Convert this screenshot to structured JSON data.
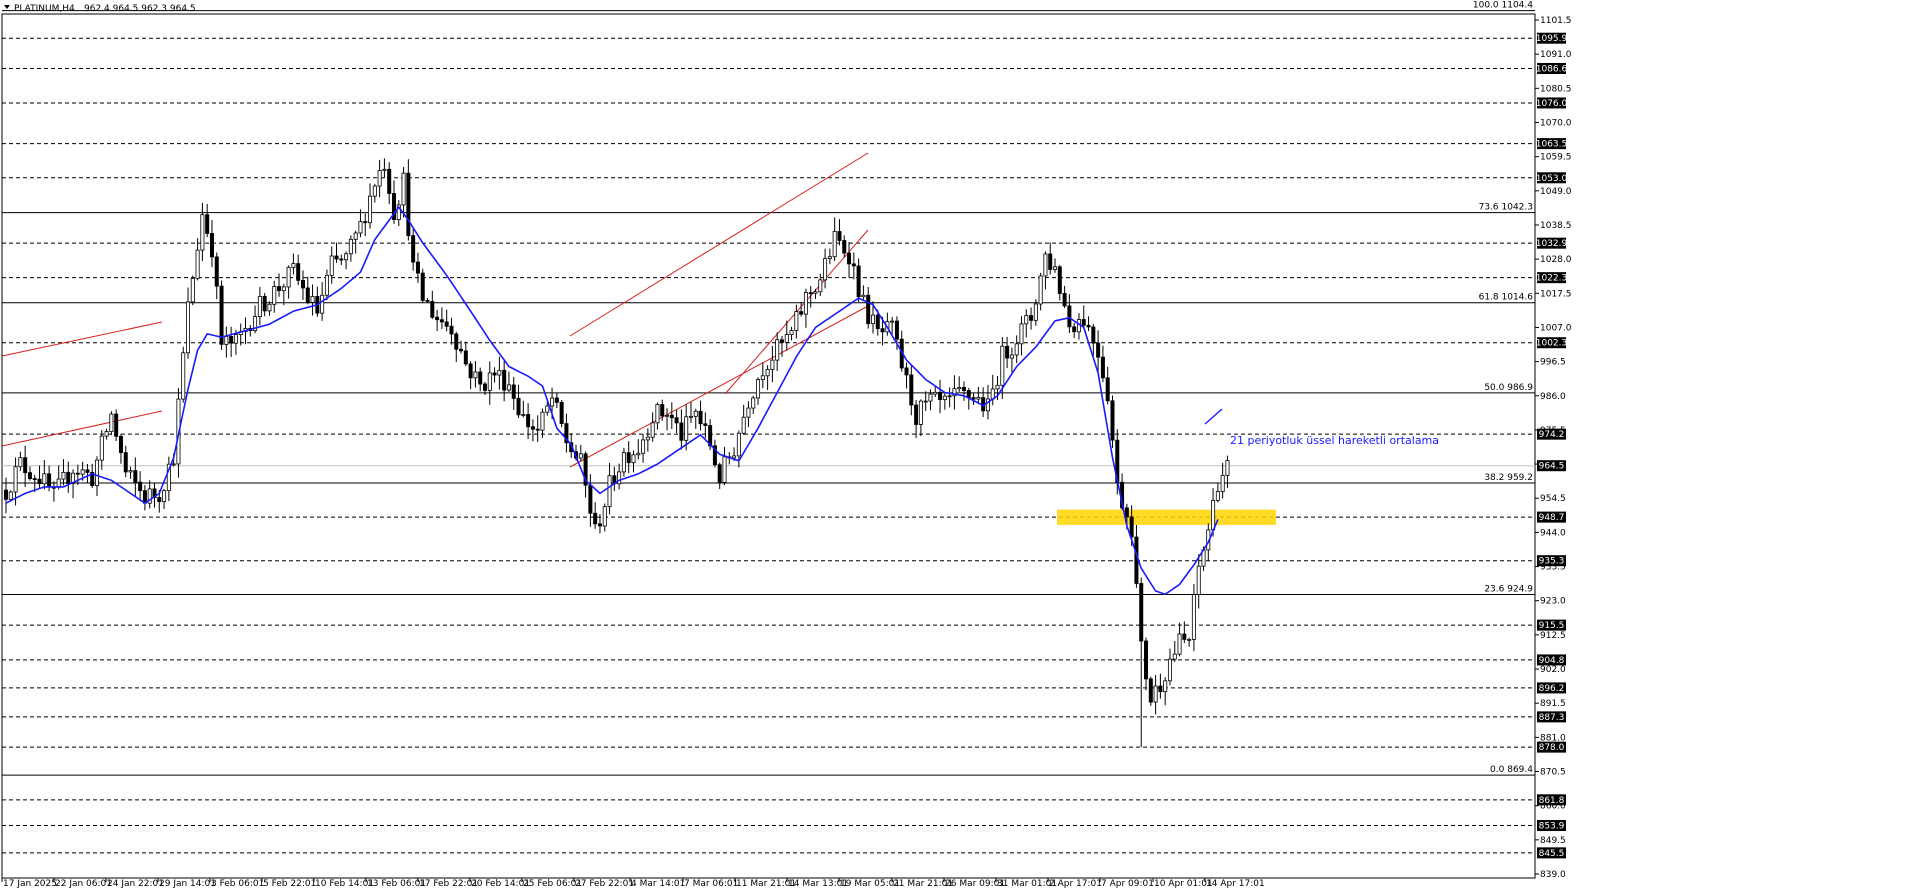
{
  "header": {
    "symbol": "PLATINUM,H4",
    "ohlc": "962.4 964.5 962.3 964.5"
  },
  "chart_data": {
    "type": "candlestick",
    "ylim": [
      835,
      1110
    ],
    "yticks": [
      1101.5,
      1091.0,
      1080.5,
      1070.0,
      1059.5,
      1049.0,
      1038.5,
      1028.0,
      1017.5,
      1007.0,
      996.5,
      986.0,
      975.5,
      965.0,
      954.5,
      944.0,
      933.5,
      923.0,
      912.5,
      902.0,
      891.5,
      881.0,
      870.5,
      860.0,
      849.5,
      839.0
    ],
    "xtick_labels": [
      "17 Jan 2025",
      "22 Jan 06:01",
      "24 Jan 22:01",
      "29 Jan 14:01",
      "3 Feb 06:01",
      "5 Feb 22:01",
      "10 Feb 14:01",
      "13 Feb 06:01",
      "17 Feb 22:01",
      "20 Feb 14:01",
      "25 Feb 06:01",
      "27 Feb 22:01",
      "4 Mar 14:01",
      "7 Mar 06:01",
      "11 Mar 21:01",
      "14 Mar 13:01",
      "19 Mar 05:01",
      "21 Mar 21:01",
      "26 Mar 09:01",
      "31 Mar 01:01",
      "2 Apr 17:01",
      "7 Apr 09:01",
      "10 Apr 01:01",
      "14 Apr 17:01"
    ],
    "levels": [
      {
        "label": "1095.9",
        "value": 1095.9
      },
      {
        "label": "1086.6",
        "value": 1086.6
      },
      {
        "label": "1076.0",
        "value": 1076.0
      },
      {
        "label": "1063.5",
        "value": 1063.5
      },
      {
        "label": "1053.0",
        "value": 1053.0
      },
      {
        "label": "1032.9",
        "value": 1032.9
      },
      {
        "label": "1022.3",
        "value": 1022.3
      },
      {
        "label": "1002.3",
        "value": 1002.3
      },
      {
        "label": "974.2",
        "value": 974.2
      },
      {
        "label": "948.7",
        "value": 948.7
      },
      {
        "label": "935.3",
        "value": 935.3
      },
      {
        "label": "915.5",
        "value": 915.5
      },
      {
        "label": "904.8",
        "value": 904.8
      },
      {
        "label": "896.2",
        "value": 896.2
      },
      {
        "label": "887.3",
        "value": 887.3
      },
      {
        "label": "878.0",
        "value": 878.0
      },
      {
        "label": "861.8",
        "value": 861.8
      },
      {
        "label": "853.9",
        "value": 853.9
      },
      {
        "label": "845.5",
        "value": 845.5
      }
    ],
    "fibonacci": [
      {
        "label": "100.0 1104.4",
        "value": 1104.4
      },
      {
        "label": "73.6 1042.3",
        "value": 1042.3
      },
      {
        "label": "61.8 1014.6",
        "value": 1014.6
      },
      {
        "label": "50.0 986.9",
        "value": 986.9
      },
      {
        "label": "38.2 959.2",
        "value": 959.2
      },
      {
        "label": "23.6 924.9",
        "value": 924.9
      },
      {
        "label": "0.0 869.4",
        "value": 869.4
      }
    ],
    "current_price": {
      "label": "964.5",
      "value": 964.5
    },
    "zone": {
      "low": 946.3,
      "high": 951.0
    },
    "annotation": "21 periyotluk üssel hareketli ortalama",
    "ema_anchors": [
      [
        0,
        953
      ],
      [
        4,
        956
      ],
      [
        8,
        958
      ],
      [
        12,
        958
      ],
      [
        18,
        962
      ],
      [
        22,
        960
      ],
      [
        26,
        956
      ],
      [
        29,
        953
      ],
      [
        32,
        956
      ],
      [
        35,
        967
      ],
      [
        38,
        988
      ],
      [
        40,
        1000
      ],
      [
        42,
        1005
      ],
      [
        45,
        1004
      ],
      [
        50,
        1006
      ],
      [
        55,
        1008
      ],
      [
        60,
        1012
      ],
      [
        65,
        1014
      ],
      [
        70,
        1019
      ],
      [
        74,
        1024
      ],
      [
        77,
        1034
      ],
      [
        80,
        1040
      ],
      [
        82,
        1044
      ],
      [
        84,
        1040
      ],
      [
        87,
        1033
      ],
      [
        92,
        1023
      ],
      [
        97,
        1012
      ],
      [
        101,
        1003
      ],
      [
        105,
        995
      ],
      [
        109,
        992
      ],
      [
        112,
        989
      ],
      [
        115,
        976
      ],
      [
        118,
        971
      ],
      [
        121,
        960
      ],
      [
        124,
        956
      ],
      [
        128,
        960
      ],
      [
        132,
        962
      ],
      [
        136,
        965
      ],
      [
        140,
        969
      ],
      [
        145,
        974
      ],
      [
        149,
        968
      ],
      [
        153,
        966
      ],
      [
        157,
        976
      ],
      [
        161,
        987
      ],
      [
        165,
        998
      ],
      [
        169,
        1007
      ],
      [
        173,
        1011
      ],
      [
        178,
        1016
      ],
      [
        181,
        1014
      ],
      [
        184,
        1007
      ],
      [
        188,
        997
      ],
      [
        192,
        991
      ],
      [
        196,
        987
      ],
      [
        200,
        986
      ],
      [
        204,
        983
      ],
      [
        207,
        986
      ],
      [
        211,
        995
      ],
      [
        215,
        1001
      ],
      [
        219,
        1009
      ],
      [
        222,
        1010
      ],
      [
        225,
        1007
      ],
      [
        228,
        993
      ],
      [
        231,
        967
      ],
      [
        234,
        946
      ],
      [
        237,
        933
      ],
      [
        240,
        926
      ],
      [
        242,
        925
      ],
      [
        245,
        928
      ],
      [
        248,
        934
      ],
      [
        251,
        941
      ],
      [
        253,
        948
      ]
    ],
    "candle_anchors": [
      [
        0,
        957
      ],
      [
        3,
        965
      ],
      [
        7,
        961
      ],
      [
        10,
        955
      ],
      [
        14,
        964
      ],
      [
        18,
        961
      ],
      [
        22,
        980
      ],
      [
        25,
        962
      ],
      [
        29,
        955
      ],
      [
        32,
        956
      ],
      [
        35,
        968
      ],
      [
        38,
        1013
      ],
      [
        41,
        1042
      ],
      [
        43,
        1032
      ],
      [
        45,
        1002
      ],
      [
        48,
        1002
      ],
      [
        52,
        1012
      ],
      [
        56,
        1018
      ],
      [
        60,
        1024
      ],
      [
        63,
        1016
      ],
      [
        65,
        1012
      ],
      [
        68,
        1026
      ],
      [
        71,
        1028
      ],
      [
        74,
        1038
      ],
      [
        77,
        1052
      ],
      [
        79,
        1058
      ],
      [
        81,
        1043
      ],
      [
        83,
        1052
      ],
      [
        85,
        1025
      ],
      [
        87,
        1016
      ],
      [
        90,
        1010
      ],
      [
        93,
        1007
      ],
      [
        96,
        996
      ],
      [
        99,
        989
      ],
      [
        102,
        993
      ],
      [
        105,
        990
      ],
      [
        108,
        979
      ],
      [
        111,
        975
      ],
      [
        114,
        985
      ],
      [
        117,
        972
      ],
      [
        120,
        965
      ],
      [
        123,
        944
      ],
      [
        126,
        958
      ],
      [
        129,
        968
      ],
      [
        132,
        970
      ],
      [
        135,
        980
      ],
      [
        138,
        981
      ],
      [
        141,
        974
      ],
      [
        144,
        981
      ],
      [
        147,
        971
      ],
      [
        149,
        961
      ],
      [
        152,
        970
      ],
      [
        155,
        985
      ],
      [
        158,
        995
      ],
      [
        161,
        1000
      ],
      [
        164,
        1005
      ],
      [
        167,
        1016
      ],
      [
        170,
        1022
      ],
      [
        173,
        1034
      ],
      [
        176,
        1030
      ],
      [
        179,
        1014
      ],
      [
        182,
        1005
      ],
      [
        185,
        1006
      ],
      [
        188,
        990
      ],
      [
        190,
        980
      ],
      [
        193,
        984
      ],
      [
        196,
        983
      ],
      [
        199,
        986
      ],
      [
        202,
        986
      ],
      [
        205,
        982
      ],
      [
        208,
        998
      ],
      [
        211,
        1004
      ],
      [
        214,
        1010
      ],
      [
        217,
        1029
      ],
      [
        219,
        1025
      ],
      [
        222,
        1008
      ],
      [
        225,
        1010
      ],
      [
        228,
        1000
      ],
      [
        230,
        987
      ],
      [
        232,
        958
      ],
      [
        235,
        946
      ],
      [
        237,
        908
      ],
      [
        239,
        893
      ],
      [
        241,
        898
      ],
      [
        243,
        905
      ],
      [
        245,
        910
      ],
      [
        247,
        911
      ],
      [
        249,
        933
      ],
      [
        251,
        945
      ],
      [
        253,
        960
      ],
      [
        255,
        964
      ]
    ]
  }
}
